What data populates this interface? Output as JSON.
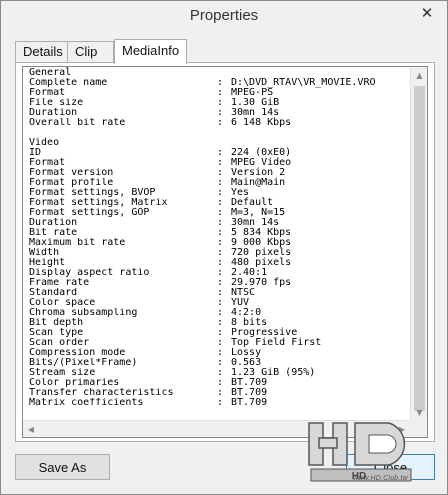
{
  "window": {
    "title": "Properties",
    "close_glyph": "✕"
  },
  "tabs": [
    {
      "label": "Details"
    },
    {
      "label": "Clip"
    },
    {
      "label": "MediaInfo",
      "selected": true
    }
  ],
  "mediainfo": {
    "general_header": "General",
    "general": [
      {
        "key": "Complete name",
        "value": "D:\\DVD_RTAV\\VR_MOVIE.VRO"
      },
      {
        "key": "Format",
        "value": "MPEG-PS"
      },
      {
        "key": "File size",
        "value": "1.30 GiB"
      },
      {
        "key": "Duration",
        "value": "30mn 14s"
      },
      {
        "key": "Overall bit rate",
        "value": "6 148 Kbps"
      }
    ],
    "video_header": "Video",
    "video": [
      {
        "key": "ID",
        "value": "224 (0xE0)"
      },
      {
        "key": "Format",
        "value": "MPEG Video"
      },
      {
        "key": "Format version",
        "value": "Version 2"
      },
      {
        "key": "Format profile",
        "value": "Main@Main"
      },
      {
        "key": "Format settings, BVOP",
        "value": "Yes"
      },
      {
        "key": "Format settings, Matrix",
        "value": "Default"
      },
      {
        "key": "Format settings, GOP",
        "value": "M=3, N=15"
      },
      {
        "key": "Duration",
        "value": "30mn 14s"
      },
      {
        "key": "Bit rate",
        "value": "5 834 Kbps"
      },
      {
        "key": "Maximum bit rate",
        "value": "9 000 Kbps"
      },
      {
        "key": "Width",
        "value": "720 pixels"
      },
      {
        "key": "Height",
        "value": "480 pixels"
      },
      {
        "key": "Display aspect ratio",
        "value": "2.40:1"
      },
      {
        "key": "Frame rate",
        "value": "29.970 fps"
      },
      {
        "key": "Standard",
        "value": "NTSC"
      },
      {
        "key": "Color space",
        "value": "YUV"
      },
      {
        "key": "Chroma subsampling",
        "value": "4:2:0"
      },
      {
        "key": "Bit depth",
        "value": "8 bits"
      },
      {
        "key": "Scan type",
        "value": "Progressive"
      },
      {
        "key": "Scan order",
        "value": "Top Field First"
      },
      {
        "key": "Compression mode",
        "value": "Lossy"
      },
      {
        "key": "Bits/(Pixel*Frame)",
        "value": "0.563"
      },
      {
        "key": "Stream size",
        "value": "1.23 GiB (95%)"
      },
      {
        "key": "Color primaries",
        "value": "BT.709"
      },
      {
        "key": "Transfer characteristics",
        "value": "BT.709"
      },
      {
        "key": "Matrix coefficients",
        "value": "BT.709"
      }
    ]
  },
  "buttons": {
    "save_as": "Save As",
    "close": "Close"
  },
  "watermark": {
    "logo_text": "HD",
    "logo_sub": "www.HD.Club.tw"
  },
  "icons": [
    "close-icon",
    "scroll-up-icon",
    "scroll-down-icon",
    "scroll-left-icon",
    "scroll-right-icon"
  ]
}
